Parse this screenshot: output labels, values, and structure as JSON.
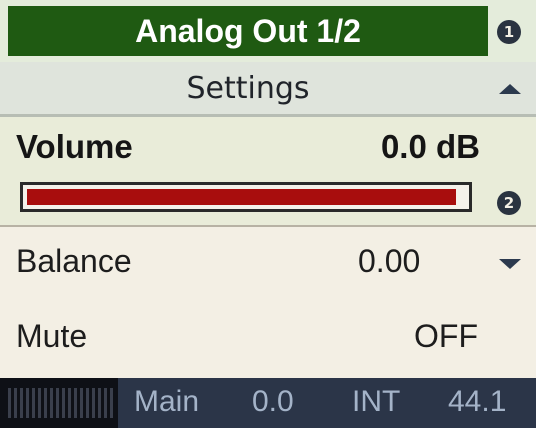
{
  "header": {
    "title": "Analog Out 1/2",
    "badge_1": "1",
    "title_color": "#1f5a12"
  },
  "menu": {
    "section_label": "Settings",
    "scroll_up_icon": "triangle-up-icon",
    "scroll_down_icon": "triangle-down-icon"
  },
  "volume": {
    "label": "Volume",
    "value": "0.0 dB",
    "level_fraction": 0.98,
    "badge_2": "2",
    "bar_color": "#a80d0d"
  },
  "balance": {
    "label": "Balance",
    "value": "0.00"
  },
  "mute": {
    "label": "Mute",
    "value": "OFF"
  },
  "status": {
    "source": "Main",
    "gain": "0.0",
    "clock": "INT",
    "rate": "44.1"
  }
}
